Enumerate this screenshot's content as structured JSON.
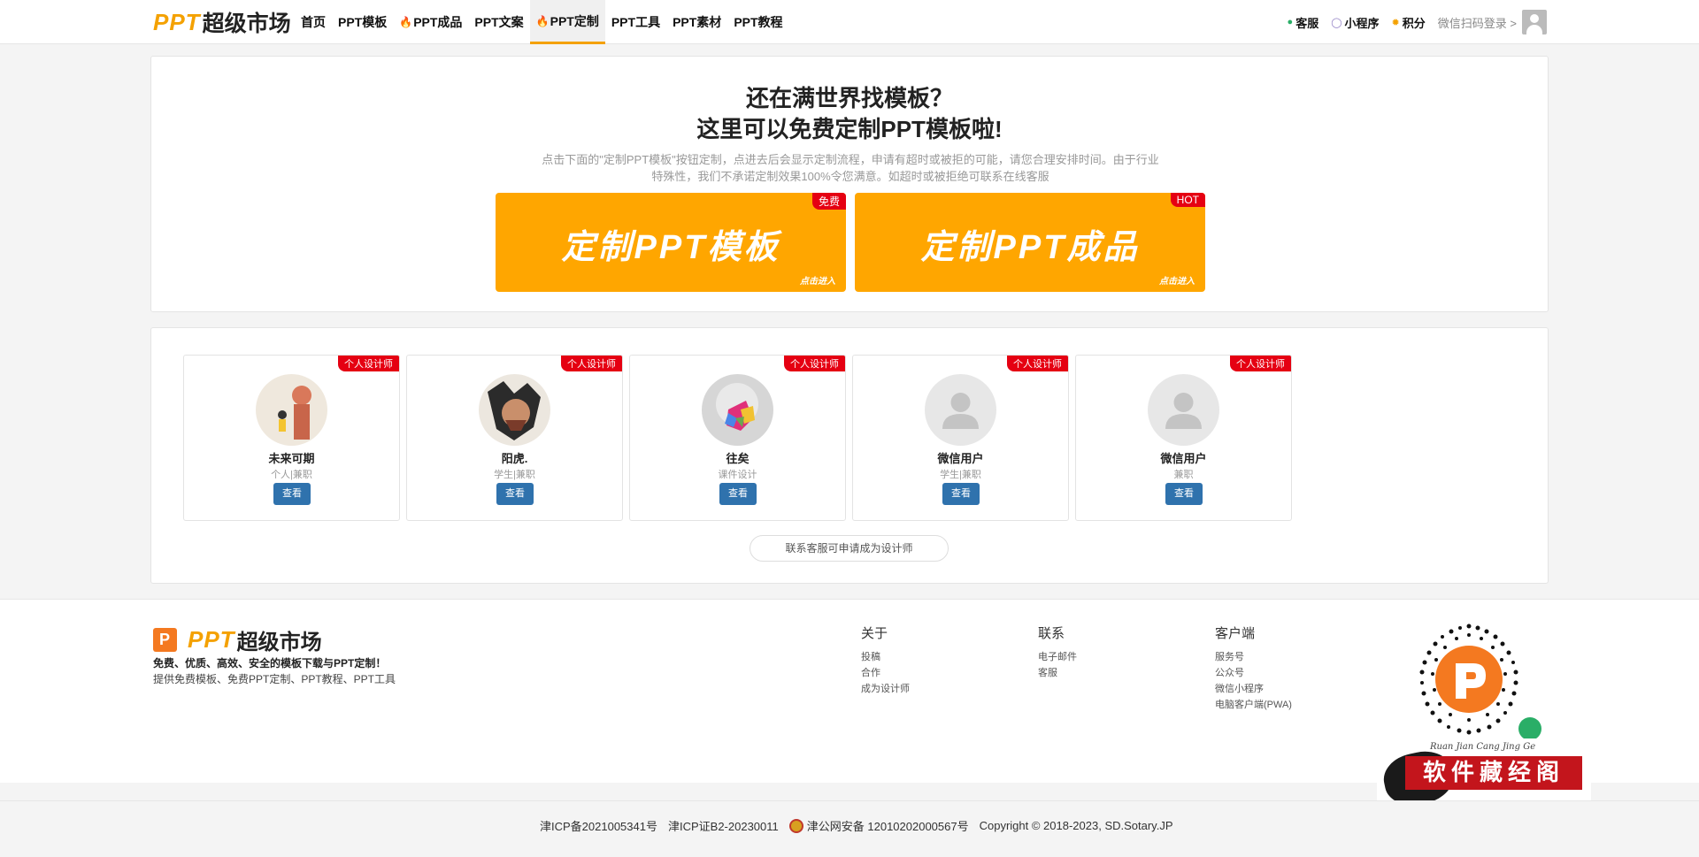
{
  "header": {
    "logo_ppt": "PPT",
    "logo_cn": "超级市场",
    "nav": [
      {
        "label": "首页",
        "hot": false,
        "active": false
      },
      {
        "label": "PPT模板",
        "hot": false,
        "active": false
      },
      {
        "label": "PPT成品",
        "hot": true,
        "active": false
      },
      {
        "label": "PPT文案",
        "hot": false,
        "active": false
      },
      {
        "label": "PPT定制",
        "hot": true,
        "active": true
      },
      {
        "label": "PPT工具",
        "hot": false,
        "active": false
      },
      {
        "label": "PPT素材",
        "hot": false,
        "active": false
      },
      {
        "label": "PPT教程",
        "hot": false,
        "active": false
      }
    ],
    "right": {
      "service": "客服",
      "mini_program": "小程序",
      "points": "积分",
      "login": "微信扫码登录 >"
    }
  },
  "hero": {
    "title1": "还在满世界找模板？",
    "title2": "这里可以免费定制PPT模板啦!",
    "desc": "点击下面的\"定制PPT模板\"按钮定制，点进去后会显示定制流程，申请有超时或被拒的可能，请您合理安排时间。由于行业特殊性，我们不承诺定制效果100%令您满意。如超时或被拒绝可联系在线客服",
    "cta1": {
      "text": "定制PPT模板",
      "badge": "免费",
      "enter": "点击进入"
    },
    "cta2": {
      "text": "定制PPT成品",
      "badge": "HOT",
      "enter": "点击进入"
    }
  },
  "designers": {
    "badge": "个人设计师",
    "view_label": "查看",
    "apply_label": "联系客服可申请成为设计师",
    "items": [
      {
        "name": "未来可期",
        "role": "个人|兼职"
      },
      {
        "name": "阳虎.",
        "role": "学生|兼职"
      },
      {
        "name": "往矣",
        "role": "课件设计"
      },
      {
        "name": "微信用户",
        "role": "学生|兼职"
      },
      {
        "name": "微信用户",
        "role": "兼职"
      }
    ]
  },
  "footer": {
    "logo_ppt": "PPT",
    "logo_cn": "超级市场",
    "slogan": "免费、优质、高效、安全的模板下载与PPT定制！",
    "sub": "提供免费模板、免费PPT定制、PPT教程、PPT工具",
    "col1": {
      "title": "关于",
      "links": [
        "投稿",
        "合作",
        "成为设计师"
      ]
    },
    "col2": {
      "title": "联系",
      "links": [
        "电子邮件",
        "客服"
      ]
    },
    "col3": {
      "title": "客户端",
      "links": [
        "服务号",
        "公众号",
        "微信小程序",
        "电脑客户端(PWA)"
      ]
    },
    "stamp_text": "软件藏经阁",
    "stamp_sub": "Ruan Jian Cang Jing Ge"
  },
  "bottom": {
    "icp": "津ICP备2021005341号",
    "icp2": "津ICP证B2-20230011",
    "police": "津公网安备 12010202000567号",
    "copyright": "Copyright © 2018-2023, SD.Sotary.JP"
  },
  "colors": {
    "accent": "#ffa600",
    "badge_red": "#e50012",
    "button_blue": "#2f72ad"
  }
}
